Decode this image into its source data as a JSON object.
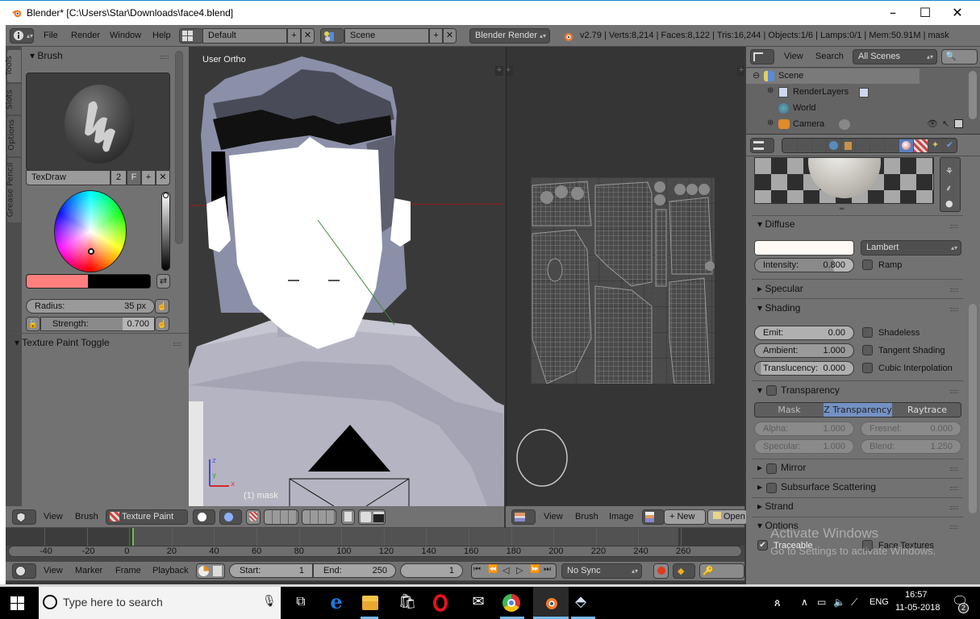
{
  "window": {
    "title": "Blender* [C:\\Users\\Star\\Downloads\\face4.blend]",
    "controls": {
      "minimize": "–",
      "maximize": "☐",
      "close": "✕"
    }
  },
  "info_header": {
    "menu": [
      "File",
      "Render",
      "Window",
      "Help"
    ],
    "layout": "Default",
    "scene": "Scene",
    "engine": "Blender Render",
    "stats": "v2.79 | Verts:8,214 | Faces:8,122 | Tris:16,244 | Objects:1/6 | Lamps:0/1 | Mem:50.91M | mask"
  },
  "tool_shelf": {
    "tabs": [
      "Tools",
      "Slots",
      "Options",
      "Grease Pencil"
    ],
    "brush_panel": {
      "title": "Brush",
      "brush_name": "TexDraw",
      "users": "2",
      "fake_user": "F",
      "color_hex": "#ff7f7f",
      "secondary_color_hex": "#000000",
      "radius_label": "Radius:",
      "radius_value": "35 px",
      "strength_label": "Strength:",
      "strength_value": "0.700"
    },
    "texture_paint_toggle": "Texture Paint Toggle"
  },
  "viewport3d": {
    "view_label": "User Ortho",
    "object_label": "(1) mask",
    "axes": {
      "x": "x",
      "y": "y",
      "z": "z"
    },
    "header": {
      "menu": [
        "View",
        "Brush"
      ],
      "mode": "Texture Paint"
    }
  },
  "image_editor": {
    "header": {
      "menu": [
        "View",
        "Brush",
        "Image"
      ],
      "new_label": "New",
      "open_label": "Open"
    }
  },
  "outliner": {
    "menu": [
      "View",
      "Search"
    ],
    "filter": "All Scenes",
    "items": [
      {
        "label": "Scene",
        "icon": "scene-icon",
        "level": 0
      },
      {
        "label": "RenderLayers",
        "icon": "renderlayers-icon",
        "level": 1
      },
      {
        "label": "World",
        "icon": "world-icon",
        "level": 1
      },
      {
        "label": "Camera",
        "icon": "camera-icon",
        "level": 1
      }
    ]
  },
  "properties": {
    "tabs": [
      "render",
      "render-layers",
      "scene",
      "world",
      "object",
      "constraints",
      "modifiers",
      "data",
      "material",
      "texture",
      "particles",
      "physics"
    ],
    "active_tab": "material",
    "diffuse": {
      "title": "Diffuse",
      "color_hex": "#fffaf5",
      "shader": "Lambert",
      "intensity_label": "Intensity:",
      "intensity_value": "0.800",
      "ramp_label": "Ramp"
    },
    "specular": {
      "title": "Specular"
    },
    "shading": {
      "title": "Shading",
      "emit_label": "Emit:",
      "emit_value": "0.00",
      "ambient_label": "Ambient:",
      "ambient_value": "1.000",
      "translucency_label": "Translucency:",
      "translucency_value": "0.000",
      "shadeless": "Shadeless",
      "tangent": "Tangent Shading",
      "cubic": "Cubic Interpolation"
    },
    "transparency": {
      "title": "Transparency",
      "modes": [
        "Mask",
        "Z Transparency",
        "Raytrace"
      ],
      "active_mode": "Z Transparency",
      "alpha_label": "Alpha:",
      "alpha_value": "1.000",
      "fresnel_label": "Fresnel:",
      "fresnel_value": "0.000",
      "specular_label": "Specular:",
      "specular_value": "1.000",
      "blend_label": "Blend:",
      "blend_value": "1.250"
    },
    "mirror": {
      "title": "Mirror"
    },
    "sss": {
      "title": "Subsurface Scattering"
    },
    "strand": {
      "title": "Strand"
    },
    "options": {
      "title": "Options",
      "traceable": "Traceable",
      "traceable_checked": true,
      "face_textures": "Face Textures"
    }
  },
  "timeline": {
    "ticks": [
      "-40",
      "-20",
      "0",
      "20",
      "40",
      "60",
      "80",
      "100",
      "120",
      "140",
      "160",
      "180",
      "200",
      "220",
      "240",
      "260"
    ],
    "menu": [
      "View",
      "Marker",
      "Frame",
      "Playback"
    ],
    "start_label": "Start:",
    "start_value": "1",
    "end_label": "End:",
    "end_value": "250",
    "current_frame": "1",
    "sync": "No Sync"
  },
  "watermark": {
    "line1": "Activate Windows",
    "line2": "Go to Settings to activate Windows."
  },
  "taskbar": {
    "search_placeholder": "Type here to search",
    "apps": [
      "task-view",
      "edge",
      "file-explorer",
      "store",
      "opera",
      "mail",
      "chrome",
      "blender",
      "app"
    ],
    "language": "ENG",
    "time": "16:57",
    "date": "11-05-2018",
    "notification_count": "2"
  }
}
